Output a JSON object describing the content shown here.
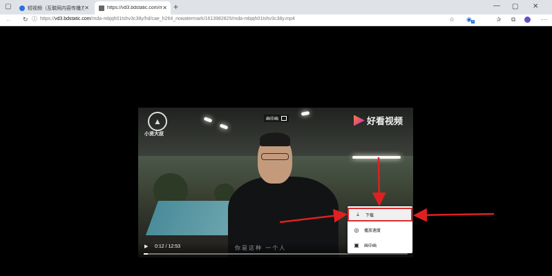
{
  "browser": {
    "tabs": [
      {
        "title": "短视频（互联网内容传播方式）",
        "close": "✕",
        "favicon_color": "#2b6fe0"
      },
      {
        "title": "https://vd3.bdstatic.com/mda-m",
        "close": "✕",
        "favicon_color": "#666666"
      }
    ],
    "new_tab": "+",
    "window": {
      "minimize": "—",
      "maximize": "▢",
      "close": "✕"
    },
    "nav": {
      "back": "←",
      "forward": "→",
      "reload": "↻",
      "info": "ⓘ"
    },
    "address_prefix": "https://",
    "address_host": "vd3.bdstatic.com",
    "address_path": "/mda-mbjqh01tshv3c38y/hd/cae_h264_nowatermark/1613982825/mda-mbjqh01tshv3c38y.mp4",
    "extension_badge": "1"
  },
  "video": {
    "logo_left_text": "小贤大叔",
    "pip_label": "画中画",
    "brand_text": "好看视频",
    "play_symbol": "▶",
    "time_display": "0:12 / 12:53",
    "progress": 0.016,
    "subtitle": "你是这种    一个人"
  },
  "context_menu": {
    "items": [
      {
        "icon": "⤓",
        "label": "下载"
      },
      {
        "icon": "◎",
        "label": "播放速度"
      },
      {
        "icon": "▣",
        "label": "画中画"
      }
    ]
  },
  "annotation_color": "#e02020"
}
